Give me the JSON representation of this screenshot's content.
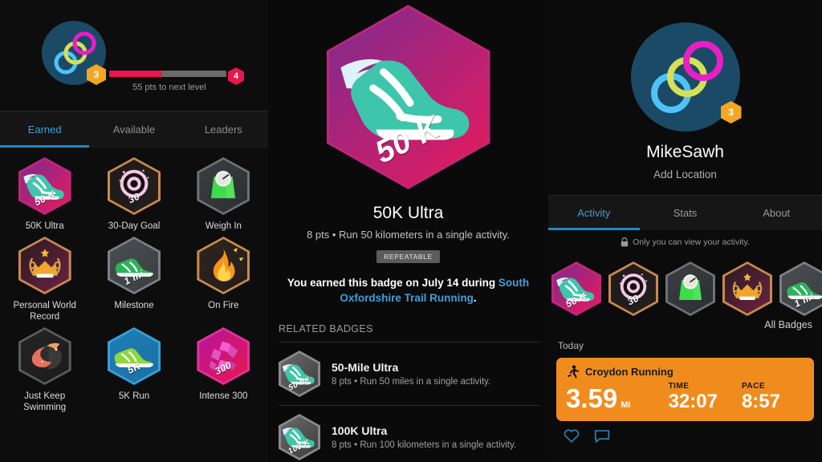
{
  "left_panel": {
    "level": {
      "current": "3",
      "next": "4",
      "progress_text": "55 pts to next level",
      "progress_pct": 45,
      "current_color": "#f5a623",
      "next_color": "#e8174c",
      "fill_color": "#e8174c"
    },
    "tabs": [
      {
        "label": "Earned",
        "active": true
      },
      {
        "label": "Available",
        "active": false
      },
      {
        "label": "Leaders",
        "active": false
      }
    ],
    "badges": [
      {
        "name": "50K Ultra",
        "icon": "winged-shoe-icon",
        "ribbon": "50 K",
        "c1": "#7d2b8f",
        "c2": "#e81a5c",
        "edge": "#c0267a"
      },
      {
        "name": "30-Day Goal",
        "icon": "target-icon",
        "ribbon": "30",
        "c1": "#1f1b1b",
        "c2": "#241e1e",
        "edge": "#c98a4b"
      },
      {
        "name": "Weigh In",
        "icon": "scale-icon",
        "ribbon": "",
        "c1": "#3b3f42",
        "c2": "#2b2f32",
        "edge": "#6c7276"
      },
      {
        "name": "Personal World Record",
        "icon": "crown-laurel-icon",
        "ribbon": "",
        "c1": "#2a1a22",
        "c2": "#6d2340",
        "edge": "#c98a4b"
      },
      {
        "name": "Milestone",
        "icon": "running-shoe-icon",
        "ribbon": "1 mi",
        "c1": "#4a4e51",
        "c2": "#3a3e41",
        "edge": "#7a8084"
      },
      {
        "name": "On Fire",
        "icon": "flame-icon",
        "ribbon": "",
        "c1": "#2c2420",
        "c2": "#241d1a",
        "edge": "#c98a4b"
      },
      {
        "name": "Just Keep Swimming",
        "icon": "fish-icon",
        "ribbon": "",
        "c1": "#242424",
        "c2": "#1b1b1b",
        "edge": "#5c5c5c"
      },
      {
        "name": "5K Run",
        "icon": "green-shoe-icon",
        "ribbon": "5K",
        "c1": "#1e7fb8",
        "c2": "#1b6fa2",
        "edge": "#3aa0d6"
      },
      {
        "name": "Intense 300",
        "icon": "shatter-icon",
        "ribbon": "300",
        "c1": "#b5169c",
        "c2": "#e8174c",
        "edge": "#e0329e"
      }
    ]
  },
  "center_panel": {
    "hero": {
      "name": "50K Ultra",
      "icon": "winged-shoe-icon",
      "ribbon": "50 K",
      "points_and_desc": "8 pts • Run 50 kilometers in a single activity.",
      "tag": "REPEATABLE",
      "earned_prefix": "You earned this badge on July 14 during ",
      "earned_link": "South Oxfordshire Trail Running",
      "earned_suffix": "."
    },
    "related_header": "RELATED BADGES",
    "related_badges": [
      {
        "title": "50-Mile Ultra",
        "desc": "8 pts • Run 50 miles in a single activity.",
        "ribbon": "50 mi",
        "icon": "winged-shoe-icon"
      },
      {
        "title": "100K Ultra",
        "desc": "8 pts • Run 100 kilometers in a single activity.",
        "ribbon": "100 K",
        "icon": "winged-shoe-icon"
      }
    ]
  },
  "right_panel": {
    "profile": {
      "name": "MikeSawh",
      "location": "Add Location",
      "level": "3"
    },
    "tabs": [
      {
        "label": "Activity",
        "active": true
      },
      {
        "label": "Stats",
        "active": false
      },
      {
        "label": "About",
        "active": false
      }
    ],
    "privacy_note": "Only you can view your activity.",
    "mini_badges": [
      {
        "name": "50K Ultra",
        "icon": "winged-shoe-icon",
        "ribbon": "50 K",
        "c1": "#7d2b8f",
        "c2": "#e81a5c",
        "edge": "#c0267a"
      },
      {
        "name": "30-Day Goal",
        "icon": "target-icon",
        "ribbon": "30",
        "c1": "#1f1b1b",
        "c2": "#241e1e",
        "edge": "#c98a4b"
      },
      {
        "name": "Weigh In",
        "icon": "scale-icon",
        "ribbon": "",
        "c1": "#3b3f42",
        "c2": "#2b2f32",
        "edge": "#6c7276"
      },
      {
        "name": "Personal World Record",
        "icon": "crown-laurel-icon",
        "ribbon": "",
        "c1": "#2a1a22",
        "c2": "#6d2340",
        "edge": "#c98a4b"
      },
      {
        "name": "Milestone",
        "icon": "running-shoe-icon",
        "ribbon": "1 mi",
        "c1": "#4a4e51",
        "c2": "#3a3e41",
        "edge": "#7a8084"
      }
    ],
    "all_badges_label": "All Badges",
    "today_label": "Today",
    "activity": {
      "title": "Croydon Running",
      "icon": "runner-icon",
      "distance_value": "3.59",
      "distance_unit": "MI",
      "time_label": "TIME",
      "time_value": "32:07",
      "pace_label": "PACE",
      "pace_value": "8:57",
      "card_color": "#f08c1e"
    },
    "social": [
      {
        "icon": "heart-icon"
      },
      {
        "icon": "comment-icon"
      }
    ]
  }
}
